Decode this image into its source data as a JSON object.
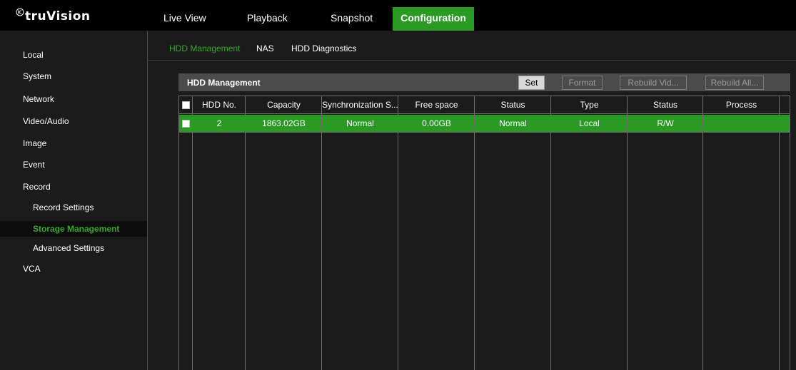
{
  "app": {
    "logo_text": "truVision"
  },
  "nav": {
    "items": [
      {
        "label": "Live View"
      },
      {
        "label": "Playback"
      },
      {
        "label": "Snapshot"
      },
      {
        "label": "Configuration",
        "active": true
      }
    ]
  },
  "sidebar": {
    "items": [
      {
        "label": "Local"
      },
      {
        "label": "System"
      },
      {
        "label": "Network"
      },
      {
        "label": "Video/Audio"
      },
      {
        "label": "Image"
      },
      {
        "label": "Event"
      },
      {
        "label": "Record"
      },
      {
        "label": "Record Settings"
      },
      {
        "label": "Storage Management",
        "active": true
      },
      {
        "label": "Advanced Settings"
      },
      {
        "label": "VCA"
      }
    ]
  },
  "tabs": [
    {
      "label": "HDD Management",
      "active": true
    },
    {
      "label": "NAS"
    },
    {
      "label": "HDD Diagnostics"
    }
  ],
  "panel": {
    "title": "HDD Management",
    "buttons": {
      "set": "Set",
      "format": "Format",
      "rebuild_video": "Rebuild Vid...",
      "rebuild_all": "Rebuild All..."
    }
  },
  "table": {
    "columns": [
      "HDD No.",
      "Capacity",
      "Synchronization S...",
      "Free space",
      "Status",
      "Type",
      "Status",
      "Process"
    ],
    "rows": [
      [
        "2",
        "1863.02GB",
        "Normal",
        "0.00GB",
        "Normal",
        "Local",
        "R/W",
        ""
      ]
    ]
  },
  "colors": {
    "accent_green": "#2a9a24",
    "text_green": "#36a82c",
    "background": "#1b1b1b",
    "topbar": "#000000"
  }
}
